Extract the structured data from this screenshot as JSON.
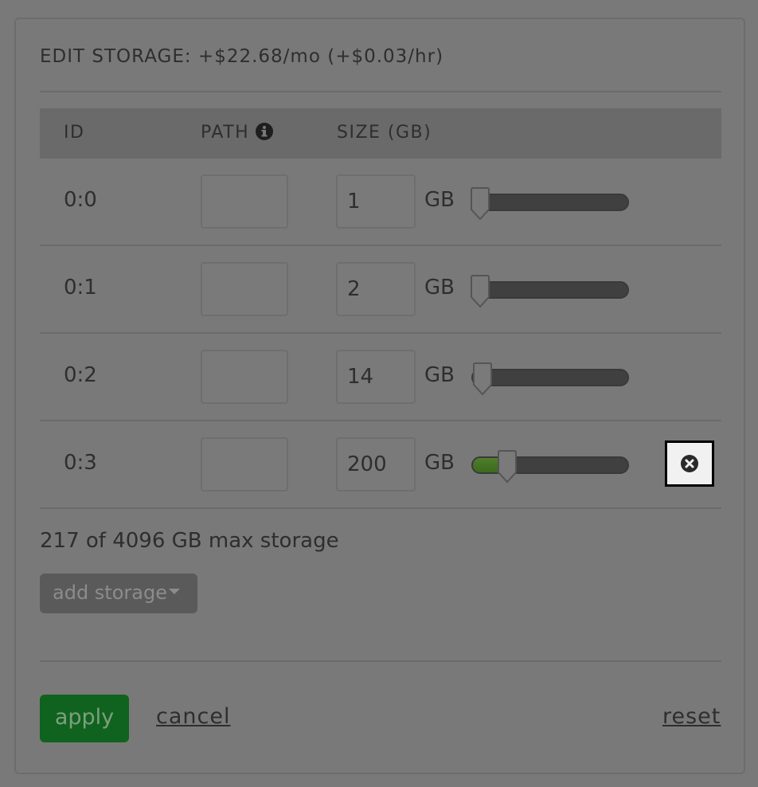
{
  "dialog": {
    "title": "EDIT STORAGE: +$22.68/mo (+$0.03/hr)"
  },
  "table": {
    "headers": {
      "id": "ID",
      "path": "PATH",
      "size": "SIZE (GB)"
    },
    "unit": "GB",
    "rows": [
      {
        "id": "0:0",
        "path": "",
        "size": "1",
        "slider_fraction": 0.0
      },
      {
        "id": "0:1",
        "path": "",
        "size": "2",
        "slider_fraction": 0.0
      },
      {
        "id": "0:2",
        "path": "",
        "size": "14",
        "slider_fraction": 0.02
      },
      {
        "id": "0:3",
        "path": "",
        "size": "200",
        "slider_fraction": 0.2,
        "removable": true
      }
    ]
  },
  "summary": "217 of 4096 GB max storage",
  "add_storage_label": "add storage",
  "footer": {
    "apply_label": "apply",
    "cancel_label": "cancel",
    "reset_label": "reset"
  },
  "icons": {
    "info": "info-circle-icon",
    "remove": "times-circle-icon",
    "caret": "caret-down-icon"
  },
  "colors": {
    "overlay": "#797979",
    "apply_button": "#10631e",
    "slider_fill": "#4f7e2b"
  }
}
